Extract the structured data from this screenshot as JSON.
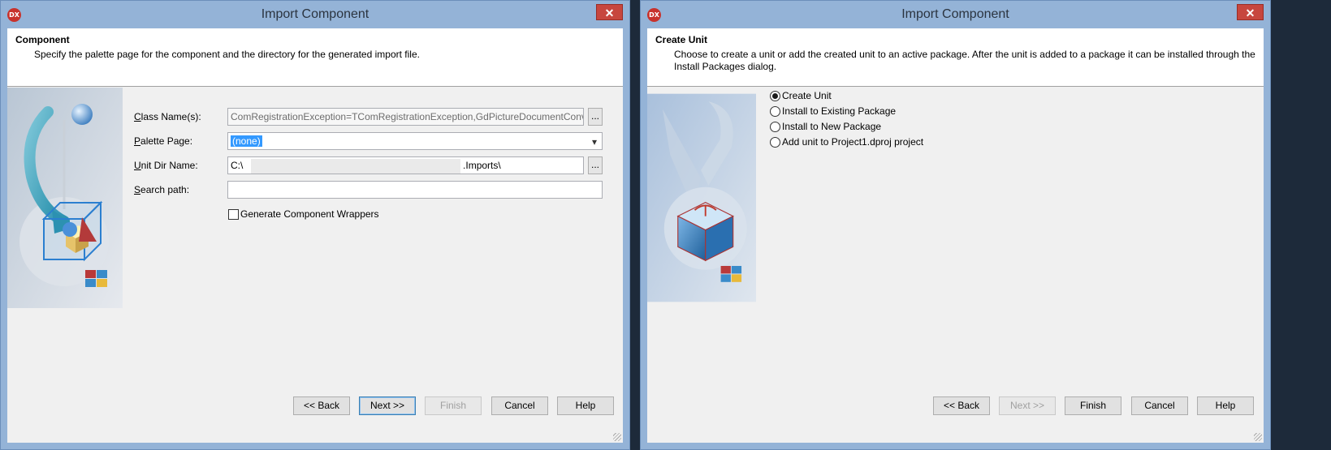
{
  "dialog1": {
    "title": "Import Component",
    "app_icon": "DX",
    "close": "✕",
    "header": {
      "title": "Component",
      "description": "Specify the palette page for the component and the directory for the generated import file."
    },
    "fields": {
      "class_names": {
        "label_key": "C",
        "label_rest": "lass Name(s):",
        "value": "ComRegistrationException=TComRegistrationException,GdPictureDocumentConverte"
      },
      "palette_page": {
        "label_key": "P",
        "label_rest": "alette Page:",
        "value": "(none)"
      },
      "unit_dir": {
        "label_key": "U",
        "label_rest": "nit Dir Name:",
        "value_prefix": "C:\\",
        "value_suffix": ".Imports\\"
      },
      "search_path": {
        "label_key": "S",
        "label_rest": "earch path:",
        "value": ""
      }
    },
    "ellipsis": "...",
    "dropdown_arrow": "▾",
    "checkbox_label": "Generate Component Wrappers",
    "checkbox_checked": false,
    "buttons": {
      "back": "<< Back",
      "next": "Next >>",
      "finish": "Finish",
      "cancel": "Cancel",
      "help": "Help"
    }
  },
  "dialog2": {
    "title": "Import Component",
    "app_icon": "DX",
    "close": "✕",
    "header": {
      "title": "Create Unit",
      "description_line1": "Choose to create a unit or add the created unit to an active package. After the unit is added to a package it can be installed through the",
      "description_line2": "Install Packages dialog."
    },
    "options": [
      {
        "label": "Create Unit",
        "checked": true
      },
      {
        "label": "Install to Existing Package",
        "checked": false
      },
      {
        "label": "Install to New Package",
        "checked": false
      },
      {
        "label": "Add unit to Project1.dproj project",
        "checked": false
      }
    ],
    "buttons": {
      "back": "<< Back",
      "next": "Next >>",
      "finish": "Finish",
      "cancel": "Cancel",
      "help": "Help"
    }
  },
  "colors": {
    "frame": "#94b3d7",
    "close": "#c7463e",
    "selection": "#3399ff",
    "client": "#f0f0f0"
  },
  "icons": [
    "app-logo-icon",
    "close-icon",
    "ellipsis-icon",
    "chevron-down-icon",
    "component-wizard-image",
    "package-wizard-image"
  ]
}
